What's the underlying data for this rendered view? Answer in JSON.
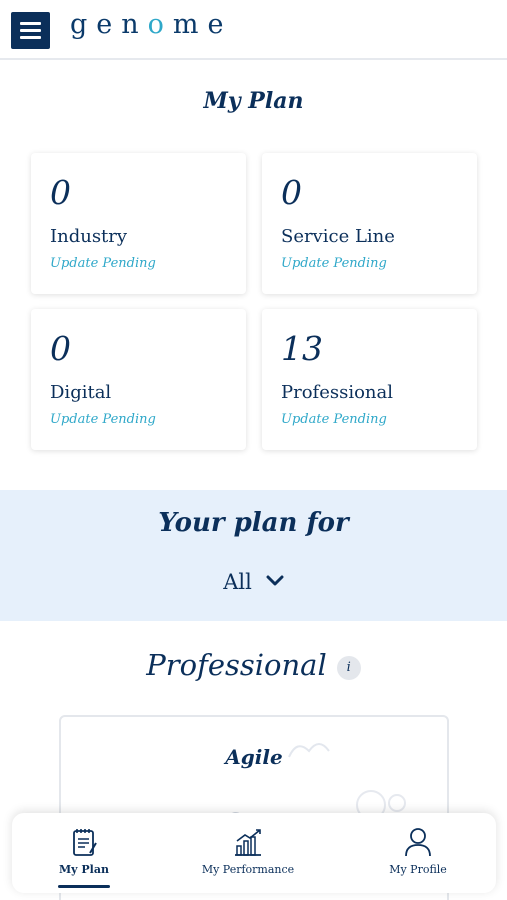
{
  "header": {
    "logo_left": "gen",
    "logo_o": "o",
    "logo_right": "me"
  },
  "my_plan": {
    "title": "My Plan",
    "cards": [
      {
        "value": "0",
        "label": "Industry",
        "status": "Update Pending"
      },
      {
        "value": "0",
        "label": "Service Line",
        "status": "Update Pending"
      },
      {
        "value": "0",
        "label": "Digital",
        "status": "Update Pending"
      },
      {
        "value": "13",
        "label": "Professional",
        "status": "Update Pending"
      }
    ]
  },
  "plan_for": {
    "title": "Your plan for",
    "selected": "All"
  },
  "category": {
    "title": "Professional",
    "info_icon": "i"
  },
  "skill": {
    "name": "Agile"
  },
  "nav": [
    {
      "label": "My Plan",
      "icon": "plan-icon",
      "active": true
    },
    {
      "label": "My Performance",
      "icon": "performance-icon",
      "active": false
    },
    {
      "label": "My Profile",
      "icon": "profile-icon",
      "active": false
    }
  ],
  "colors": {
    "primary": "#0b2f5a",
    "accent": "#2fa8c9",
    "band": "#e6f0fb"
  }
}
